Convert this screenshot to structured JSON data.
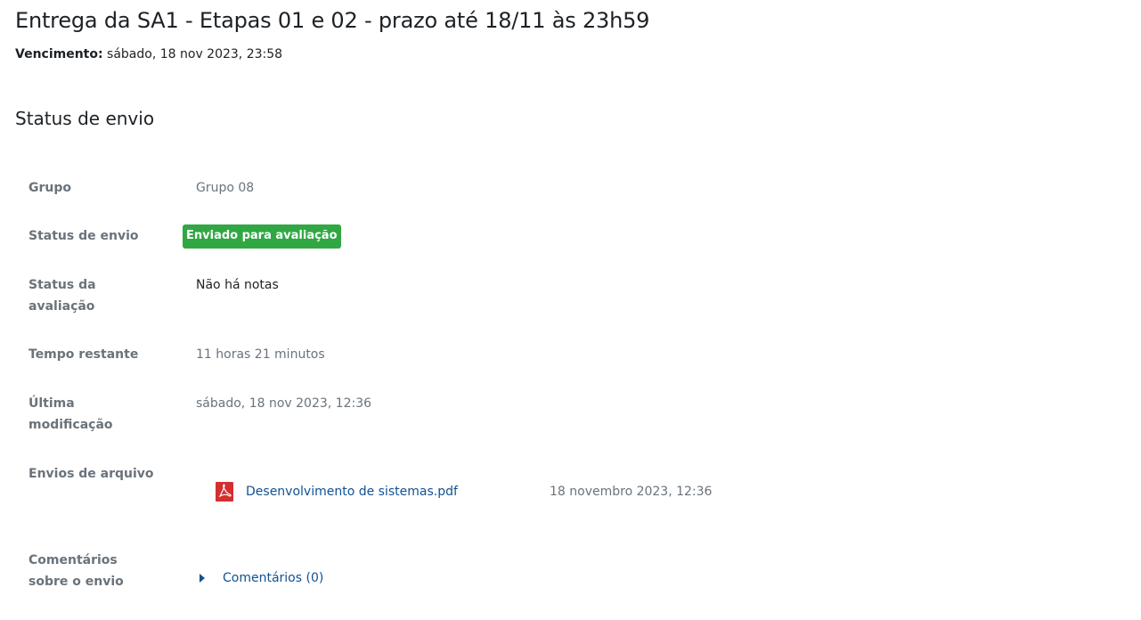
{
  "page_title": "Entrega da SA1 - Etapas 01 e 02 - prazo até 18/11 às 23h59",
  "due": {
    "label": "Vencimento:",
    "value": "sábado, 18 nov 2023, 23:58"
  },
  "section_title": "Status de envio",
  "rows": {
    "group": {
      "label": "Grupo",
      "value": "Grupo 08"
    },
    "submission_status": {
      "label": "Status de envio",
      "value": "Enviado para avaliação",
      "badge_color": "#31a744"
    },
    "grading_status": {
      "label": "Status da avaliação",
      "value": "Não há notas"
    },
    "time_remaining": {
      "label": "Tempo restante",
      "value": "11 horas 21 minutos"
    },
    "last_modified": {
      "label": "Última modificação",
      "value": "sábado, 18 nov 2023, 12:36"
    },
    "file_submissions": {
      "label": "Envios de arquivo",
      "files": [
        {
          "icon": "pdf-icon",
          "name": "Desenvolvimento de sistemas.pdf",
          "date": "18 novembro 2023, 12:36"
        }
      ]
    },
    "submission_comments": {
      "label": "Comentários sobre o envio",
      "link": "Comentários (0)",
      "icon": "caret-right-icon"
    }
  },
  "colors": {
    "link": "#115293",
    "muted": "#6a737b",
    "text": "#1d2125"
  }
}
